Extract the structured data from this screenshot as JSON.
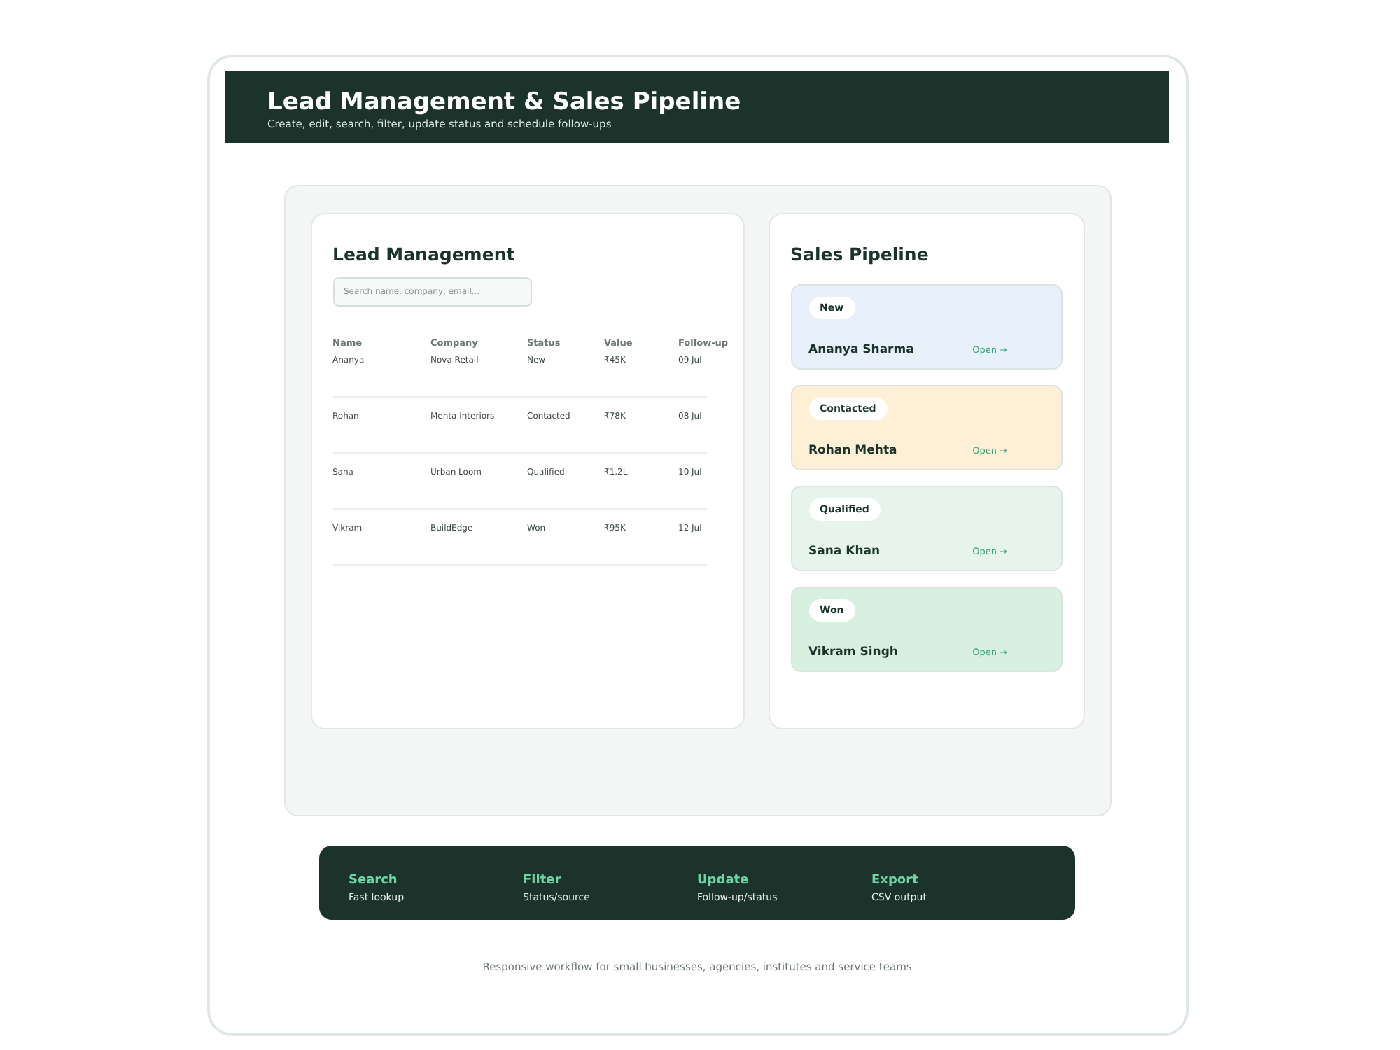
{
  "header": {
    "title": "Lead Management & Sales Pipeline",
    "subtitle": "Create, edit, search, filter, update status and schedule follow-ups"
  },
  "leads": {
    "title": "Lead Management",
    "search": {
      "placeholder": "Search name, company, email..."
    },
    "columns": [
      "Name",
      "Company",
      "Status",
      "Value",
      "Follow-up"
    ],
    "rows": [
      {
        "cells": [
          "Ananya",
          "Nova Retail",
          "New",
          "₹45K",
          "09 Jul"
        ]
      },
      {
        "cells": [
          "Rohan",
          "Mehta Interiors",
          "Contacted",
          "₹78K",
          "08 Jul"
        ]
      },
      {
        "cells": [
          "Sana",
          "Urban Loom",
          "Qualified",
          "₹1.2L",
          "10 Jul"
        ]
      },
      {
        "cells": [
          "Vikram",
          "BuildEdge",
          "Won",
          "₹95K",
          "12 Jul"
        ]
      }
    ]
  },
  "pipeline": {
    "title": "Sales Pipeline",
    "cards": [
      {
        "stage": "New",
        "name": "Ananya Sharma",
        "link": "Open →",
        "color": "#e8f0fc"
      },
      {
        "stage": "Contacted",
        "name": "Rohan Mehta",
        "link": "Open →",
        "color": "#fdf0d6"
      },
      {
        "stage": "Qualified",
        "name": "Sana Khan",
        "link": "Open →",
        "color": "#e6f4ec"
      },
      {
        "stage": "Won",
        "name": "Vikram Singh",
        "link": "Open →",
        "color": "#d7f0e0"
      }
    ]
  },
  "features": [
    {
      "title": "Search",
      "text": "Fast lookup"
    },
    {
      "title": "Filter",
      "text": "Status/source"
    },
    {
      "title": "Update",
      "text": "Follow-up/status"
    },
    {
      "title": "Export",
      "text": "CSV output"
    }
  ],
  "footer": "Responsive workflow for small businesses, agencies, institutes and service teams"
}
